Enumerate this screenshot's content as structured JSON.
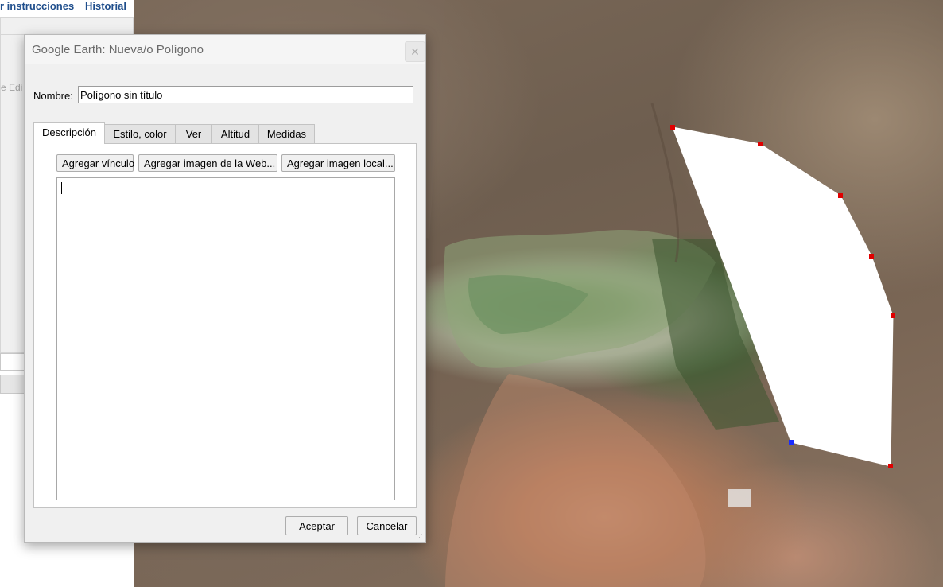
{
  "sidebar": {
    "link_instructions": "r instrucciones",
    "link_history": "Historial",
    "edit_hint": "e Edi"
  },
  "dialog": {
    "title": "Google Earth: Nueva/o Polígono",
    "close_icon": "close-icon",
    "name_label": "Nombre:",
    "name_value": "Polígono sin título",
    "tabs": [
      {
        "label": "Descripción",
        "active": true
      },
      {
        "label": "Estilo, color",
        "active": false
      },
      {
        "label": "Ver",
        "active": false
      },
      {
        "label": "Altitud",
        "active": false
      },
      {
        "label": "Medidas",
        "active": false
      }
    ],
    "buttons": {
      "add_link": "Agregar vínculo",
      "add_web_image": "Agregar imagen de la Web...",
      "add_local_image": "Agregar imagen local..."
    },
    "description_value": "",
    "ok": "Aceptar",
    "cancel": "Cancelar"
  },
  "map": {
    "polygon_fill": "#ffffff",
    "vertex_color": "#e00000",
    "selected_vertex_color": "#1a2cff"
  }
}
